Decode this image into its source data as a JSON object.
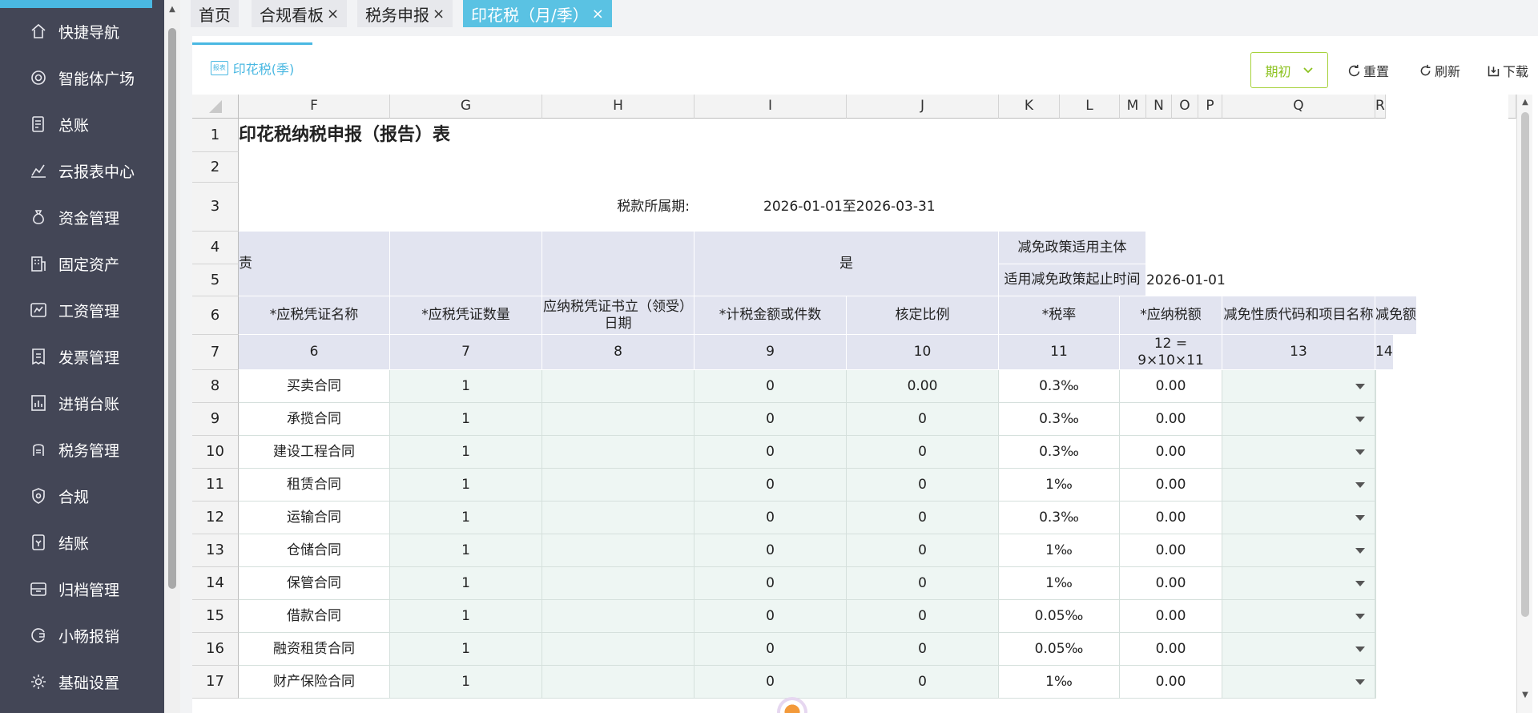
{
  "sidebar": {
    "items": [
      {
        "label": "快捷导航",
        "icon": "home-icon"
      },
      {
        "label": "智能体广场",
        "icon": "target-icon"
      },
      {
        "label": "总账",
        "icon": "ledger-icon"
      },
      {
        "label": "云报表中心",
        "icon": "chart-icon"
      },
      {
        "label": "资金管理",
        "icon": "money-bag-icon"
      },
      {
        "label": "固定资产",
        "icon": "building-icon"
      },
      {
        "label": "工资管理",
        "icon": "salary-icon"
      },
      {
        "label": "发票管理",
        "icon": "invoice-icon"
      },
      {
        "label": "进销台账",
        "icon": "inventory-icon"
      },
      {
        "label": "税务管理",
        "icon": "tax-icon"
      },
      {
        "label": "合规",
        "icon": "shield-icon"
      },
      {
        "label": "结账",
        "icon": "close-books-icon"
      },
      {
        "label": "归档管理",
        "icon": "archive-icon"
      },
      {
        "label": "小畅报销",
        "icon": "reimburse-icon"
      },
      {
        "label": "基础设置",
        "icon": "gear-icon"
      }
    ]
  },
  "tabs": [
    {
      "label": "首页",
      "closable": false
    },
    {
      "label": "合规看板",
      "closable": true
    },
    {
      "label": "税务申报",
      "closable": true
    },
    {
      "label": "印花税（月/季）",
      "closable": true,
      "active": true
    }
  ],
  "close_glyph": "×",
  "subtab": {
    "label": "印花税(季)",
    "icon_text": "报表"
  },
  "toolbar": {
    "period_label": "期初",
    "reset_label": "重置",
    "refresh_label": "刷新",
    "download_label": "下载"
  },
  "sheet": {
    "columns": [
      "F",
      "G",
      "H",
      "I",
      "J",
      "K",
      "L",
      "M",
      "N",
      "O",
      "P",
      "Q",
      "R"
    ],
    "row_numbers": [
      "1",
      "2",
      "3",
      "4",
      "5",
      "6",
      "7",
      "8",
      "9",
      "10",
      "11",
      "12",
      "13",
      "14",
      "15",
      "16",
      "17"
    ],
    "title": "印花税纳税申报（报告）表",
    "period_label": "税款所属期:",
    "period_value": "2026-01-01至2026-03-31",
    "row4_left_fragment": "责",
    "yes_value": "是",
    "reduction_subject_label": "减免政策适用主体",
    "reduction_period_label": "适用减免政策起止时间",
    "reduction_period_value": "2026-01-01",
    "headers": {
      "f": "*应税凭证名称",
      "g": "*应税凭证数量",
      "h": "应纳税凭证书立（领受）日期",
      "i": "*计税金额或件数",
      "j": "核定比例",
      "k": "*税率",
      "m": "*应纳税额",
      "q": "减免性质代码和项目名称",
      "r": "减免额"
    },
    "col_numbers": {
      "f": "6",
      "g": "7",
      "h": "8",
      "i": "9",
      "j": "10",
      "k": "11",
      "m": "12 = 9×10×11",
      "q": "13",
      "r": "14"
    },
    "rows": [
      {
        "name": "买卖合同",
        "qty": "1",
        "amount": "0",
        "ratio": "0.00",
        "rate": "0.3‰",
        "tax": "0.00"
      },
      {
        "name": "承揽合同",
        "qty": "1",
        "amount": "0",
        "ratio": "0",
        "rate": "0.3‰",
        "tax": "0.00"
      },
      {
        "name": "建设工程合同",
        "qty": "1",
        "amount": "0",
        "ratio": "0",
        "rate": "0.3‰",
        "tax": "0.00"
      },
      {
        "name": "租赁合同",
        "qty": "1",
        "amount": "0",
        "ratio": "0",
        "rate": "1‰",
        "tax": "0.00"
      },
      {
        "name": "运输合同",
        "qty": "1",
        "amount": "0",
        "ratio": "0",
        "rate": "0.3‰",
        "tax": "0.00"
      },
      {
        "name": "仓储合同",
        "qty": "1",
        "amount": "0",
        "ratio": "0",
        "rate": "1‰",
        "tax": "0.00"
      },
      {
        "name": "保管合同",
        "qty": "1",
        "amount": "0",
        "ratio": "0",
        "rate": "1‰",
        "tax": "0.00"
      },
      {
        "name": "借款合同",
        "qty": "1",
        "amount": "0",
        "ratio": "0",
        "rate": "0.05‰",
        "tax": "0.00"
      },
      {
        "name": "融资租赁合同",
        "qty": "1",
        "amount": "0",
        "ratio": "0",
        "rate": "0.05‰",
        "tax": "0.00"
      },
      {
        "name": "财产保险合同",
        "qty": "1",
        "amount": "0",
        "ratio": "0",
        "rate": "1‰",
        "tax": "0.00"
      }
    ]
  }
}
